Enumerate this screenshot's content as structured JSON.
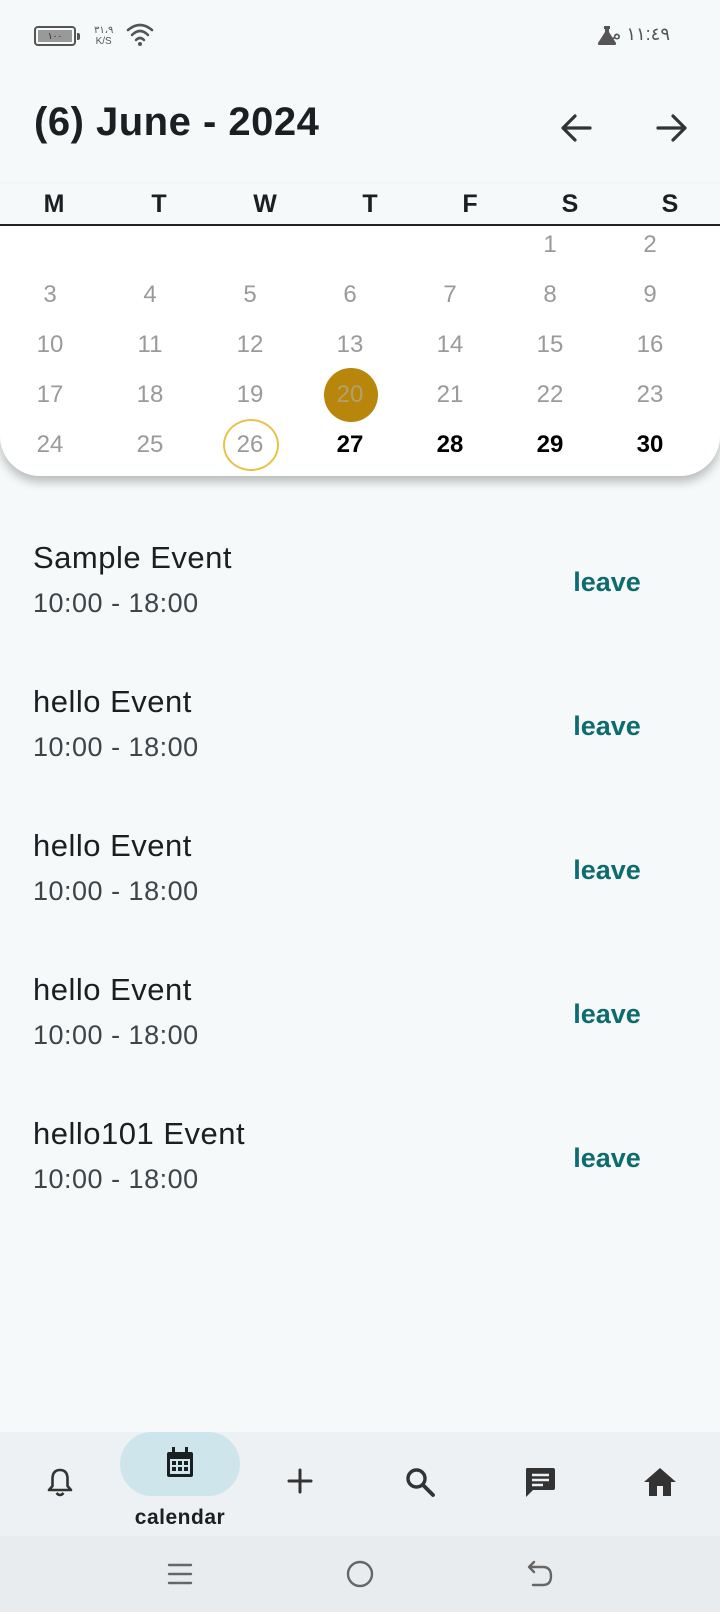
{
  "status_bar": {
    "battery_level": "١٠٠",
    "net_speed_value": "٣١،٩",
    "net_speed_unit": "K/S",
    "time": "١١:٤٩ م"
  },
  "header": {
    "title": "(6) June - 2024"
  },
  "calendar": {
    "weekdays": [
      "M",
      "T",
      "W",
      "T",
      "F",
      "S",
      "S"
    ],
    "selected_day": "20",
    "today": "26"
  },
  "events": [
    {
      "title": "Sample Event",
      "time": "10:00 - 18:00",
      "action": "leave"
    },
    {
      "title": "hello Event",
      "time": "10:00 - 18:00",
      "action": "leave"
    },
    {
      "title": "hello Event",
      "time": "10:00 - 18:00",
      "action": "leave"
    },
    {
      "title": "hello Event",
      "time": "10:00 - 18:00",
      "action": "leave"
    },
    {
      "title": "hello101 Event",
      "time": "10:00 - 18:00",
      "action": "leave"
    }
  ],
  "bottom_nav": {
    "items": [
      {
        "icon": "bell-icon"
      },
      {
        "icon": "calendar-icon",
        "label": "calendar",
        "active": true
      },
      {
        "icon": "plus-icon"
      },
      {
        "icon": "search-icon"
      },
      {
        "icon": "chat-icon"
      },
      {
        "icon": "home-icon"
      }
    ]
  },
  "colors": {
    "accent_selected": "#b8860b",
    "today_ring": "#e6c34a",
    "action_text": "#0e6b70",
    "nav_pill": "#cfe5ec"
  }
}
